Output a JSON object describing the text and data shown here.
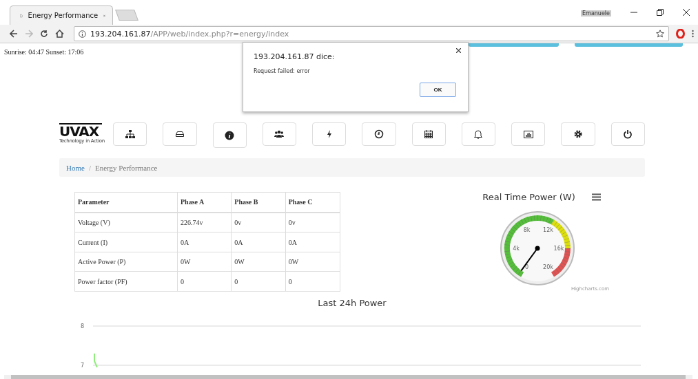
{
  "browser": {
    "tab_title": "Energy Performance",
    "user": "Emanuele",
    "url_host": "193.204.161.87",
    "url_path": "/APP/web/index.php?r=energy/index"
  },
  "sun_info": "Sunrise: 04:47 Sunset: 17:06",
  "logo": {
    "name": "UVAX",
    "tagline": "Technology in Action"
  },
  "breadcrumb": [
    {
      "label": "Home",
      "kind": "link"
    },
    {
      "label": "Energy Performance",
      "kind": "current",
      "separator": "/"
    }
  ],
  "table": {
    "columns": [
      "Parameter",
      "Phase A",
      "Phase B",
      "Phase C"
    ],
    "rows": [
      [
        "Voltage (V)",
        "226.74v",
        "0v",
        "0v"
      ],
      [
        "Current (I)",
        "0A",
        "0A",
        "0A"
      ],
      [
        "Active Power (P)",
        "0W",
        "0W",
        "0W"
      ],
      [
        "Power factor (PF)",
        "0",
        "0",
        "0"
      ]
    ]
  },
  "gauge": {
    "title": "Real Time Power (W)",
    "labels": [
      "0",
      "4k",
      "8k",
      "12k",
      "16k",
      "20k"
    ],
    "credit": "Highcharts.com"
  },
  "chart": {
    "title": "Last 24h Power",
    "axis_labels": [
      "8",
      "7"
    ]
  },
  "dialog": {
    "title": "193.204.161.87 dice:",
    "message": "Request failed: error",
    "button": "OK"
  }
}
